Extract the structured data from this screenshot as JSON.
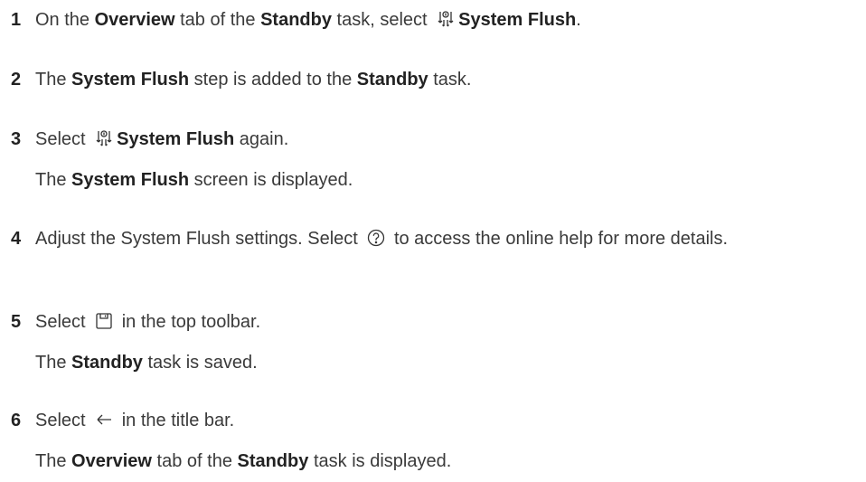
{
  "steps": [
    {
      "number": "1",
      "pre": "On the ",
      "b1": "Overview",
      "mid1": " tab of the ",
      "b2": "Standby",
      "mid2": " task, select ",
      "icon": "system-flush-icon",
      "b3": "System Flush",
      "post": "."
    },
    {
      "number": "2",
      "pre": "The ",
      "b1": "System Flush",
      "mid1": " step is added to the ",
      "b2": "Standby",
      "post": " task."
    },
    {
      "number": "3",
      "pre": "Select ",
      "icon": "system-flush-icon",
      "b1": "System Flush",
      "post": " again.",
      "result_pre": "The ",
      "result_b": "System Flush",
      "result_post": " screen is displayed."
    },
    {
      "number": "4",
      "pre": "Adjust the System Flush settings. Select ",
      "icon": "help-circle-icon",
      "post": " to access the online help for more details."
    },
    {
      "number": "5",
      "pre": "Select ",
      "icon": "save-icon",
      "post": " in the top toolbar.",
      "result_pre": "The ",
      "result_b": "Standby",
      "result_post": " task is saved."
    },
    {
      "number": "6",
      "pre": "Select ",
      "icon": "arrow-left-icon",
      "post": " in the title bar.",
      "result_pre": "The ",
      "result_b1": "Overview",
      "result_mid": " tab of the ",
      "result_b2": "Standby",
      "result_post": " task is displayed."
    }
  ]
}
